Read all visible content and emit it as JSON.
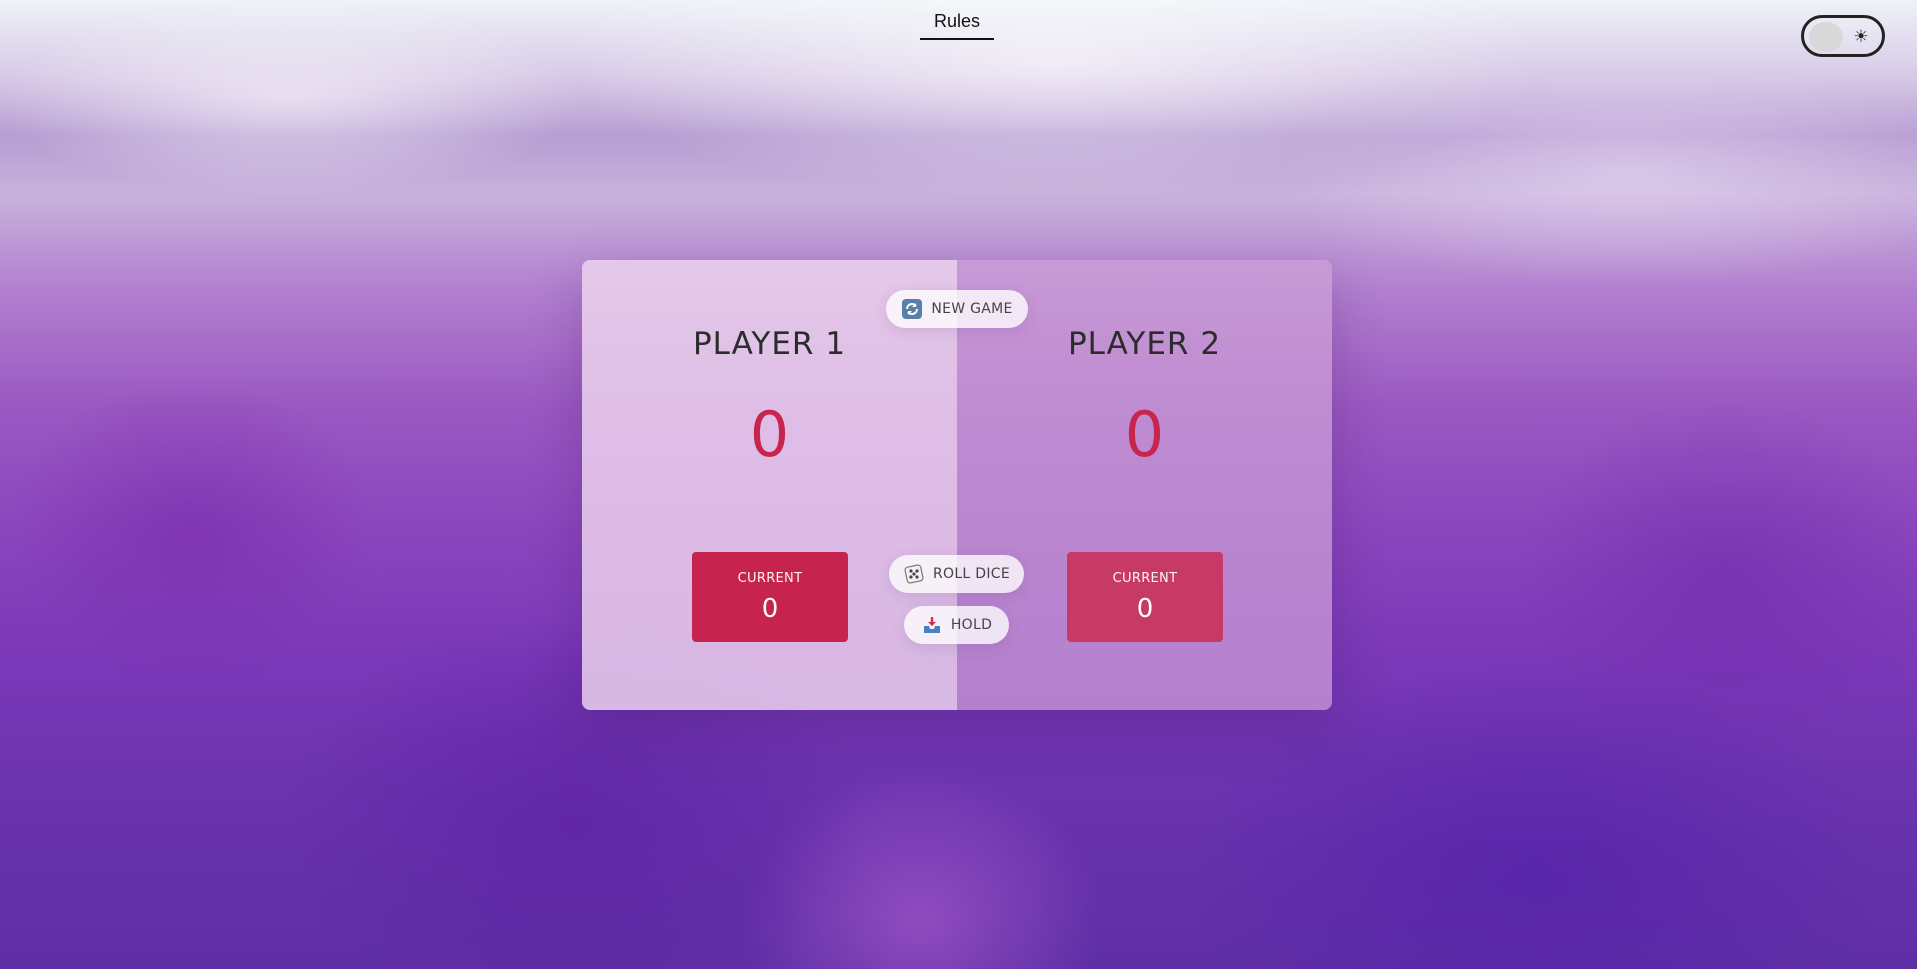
{
  "header": {
    "rules_label": "Rules"
  },
  "theme_toggle": {
    "icon": "sun-icon"
  },
  "players": [
    {
      "name": "PLAYER 1",
      "score": "0",
      "current_label": "CURRENT",
      "current_score": "0"
    },
    {
      "name": "PLAYER 2",
      "score": "0",
      "current_label": "CURRENT",
      "current_score": "0"
    }
  ],
  "controls": {
    "new_game": "NEW GAME",
    "roll_dice": "ROLL DICE",
    "hold": "HOLD"
  },
  "colors": {
    "score": "#c7254e",
    "current_player1": "#c6234f",
    "current_player2": "#c73a66"
  }
}
